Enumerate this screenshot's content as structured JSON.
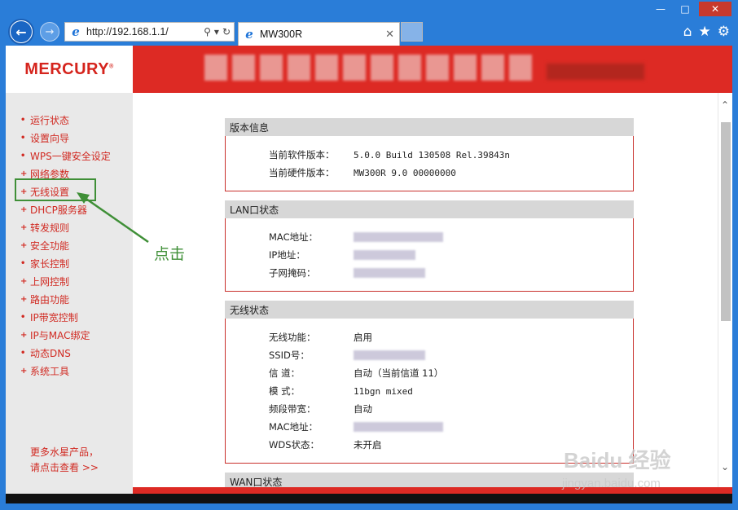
{
  "browser": {
    "address_url": "http://192.168.1.1/",
    "tab_title": "MW300R",
    "colors": {
      "frame": "#2a7dd8",
      "close_button": "#c7392c"
    }
  },
  "router": {
    "logo": "MERCURY",
    "logo_mark": "®",
    "brand_colors": {
      "header": "#dd2a24",
      "menu_text": "#d12a22"
    },
    "menu": [
      {
        "label": "运行状态",
        "bullet": "•"
      },
      {
        "label": "设置向导",
        "bullet": "•"
      },
      {
        "label": "WPS一键安全设定",
        "bullet": "•"
      },
      {
        "label": "网络参数",
        "bullet": "+"
      },
      {
        "label": "无线设置",
        "bullet": "+"
      },
      {
        "label": "DHCP服务器",
        "bullet": "+"
      },
      {
        "label": "转发规则",
        "bullet": "+"
      },
      {
        "label": "安全功能",
        "bullet": "+"
      },
      {
        "label": "家长控制",
        "bullet": "•"
      },
      {
        "label": "上网控制",
        "bullet": "+"
      },
      {
        "label": "路由功能",
        "bullet": "+"
      },
      {
        "label": "IP带宽控制",
        "bullet": "•"
      },
      {
        "label": "IP与MAC绑定",
        "bullet": "+"
      },
      {
        "label": "动态DNS",
        "bullet": "•"
      },
      {
        "label": "系统工具",
        "bullet": "+"
      }
    ],
    "more_line1": "更多水星产品，",
    "more_line2": "请点击查看 >>",
    "version": {
      "title": "版本信息",
      "software_label": "当前软件版本：",
      "software_value": "5.0.0 Build 130508 Rel.39843n",
      "hardware_label": "当前硬件版本：",
      "hardware_value": "MW300R 9.0 00000000"
    },
    "lan": {
      "title": "LAN口状态",
      "mac_label": "MAC地址：",
      "ip_label": "IP地址：",
      "mask_label": "子网掩码："
    },
    "wireless": {
      "title": "无线状态",
      "func_label": "无线功能：",
      "func_value": "启用",
      "ssid_label": "SSID号：",
      "channel_label": "信 道：",
      "channel_value": "自动（当前信道 11）",
      "mode_label": "模 式：",
      "mode_value": "11bgn mixed",
      "bandwidth_label": "频段带宽：",
      "bandwidth_value": "自动",
      "mac_label": "MAC地址：",
      "wds_label": "WDS状态：",
      "wds_value": "未开启"
    },
    "wan": {
      "title": "WAN口状态"
    }
  },
  "annotation": {
    "text": "点击",
    "color": "#3f8f37"
  },
  "watermark": {
    "text": "Baidu 经验",
    "sub": "jingyan.baidu.com"
  }
}
